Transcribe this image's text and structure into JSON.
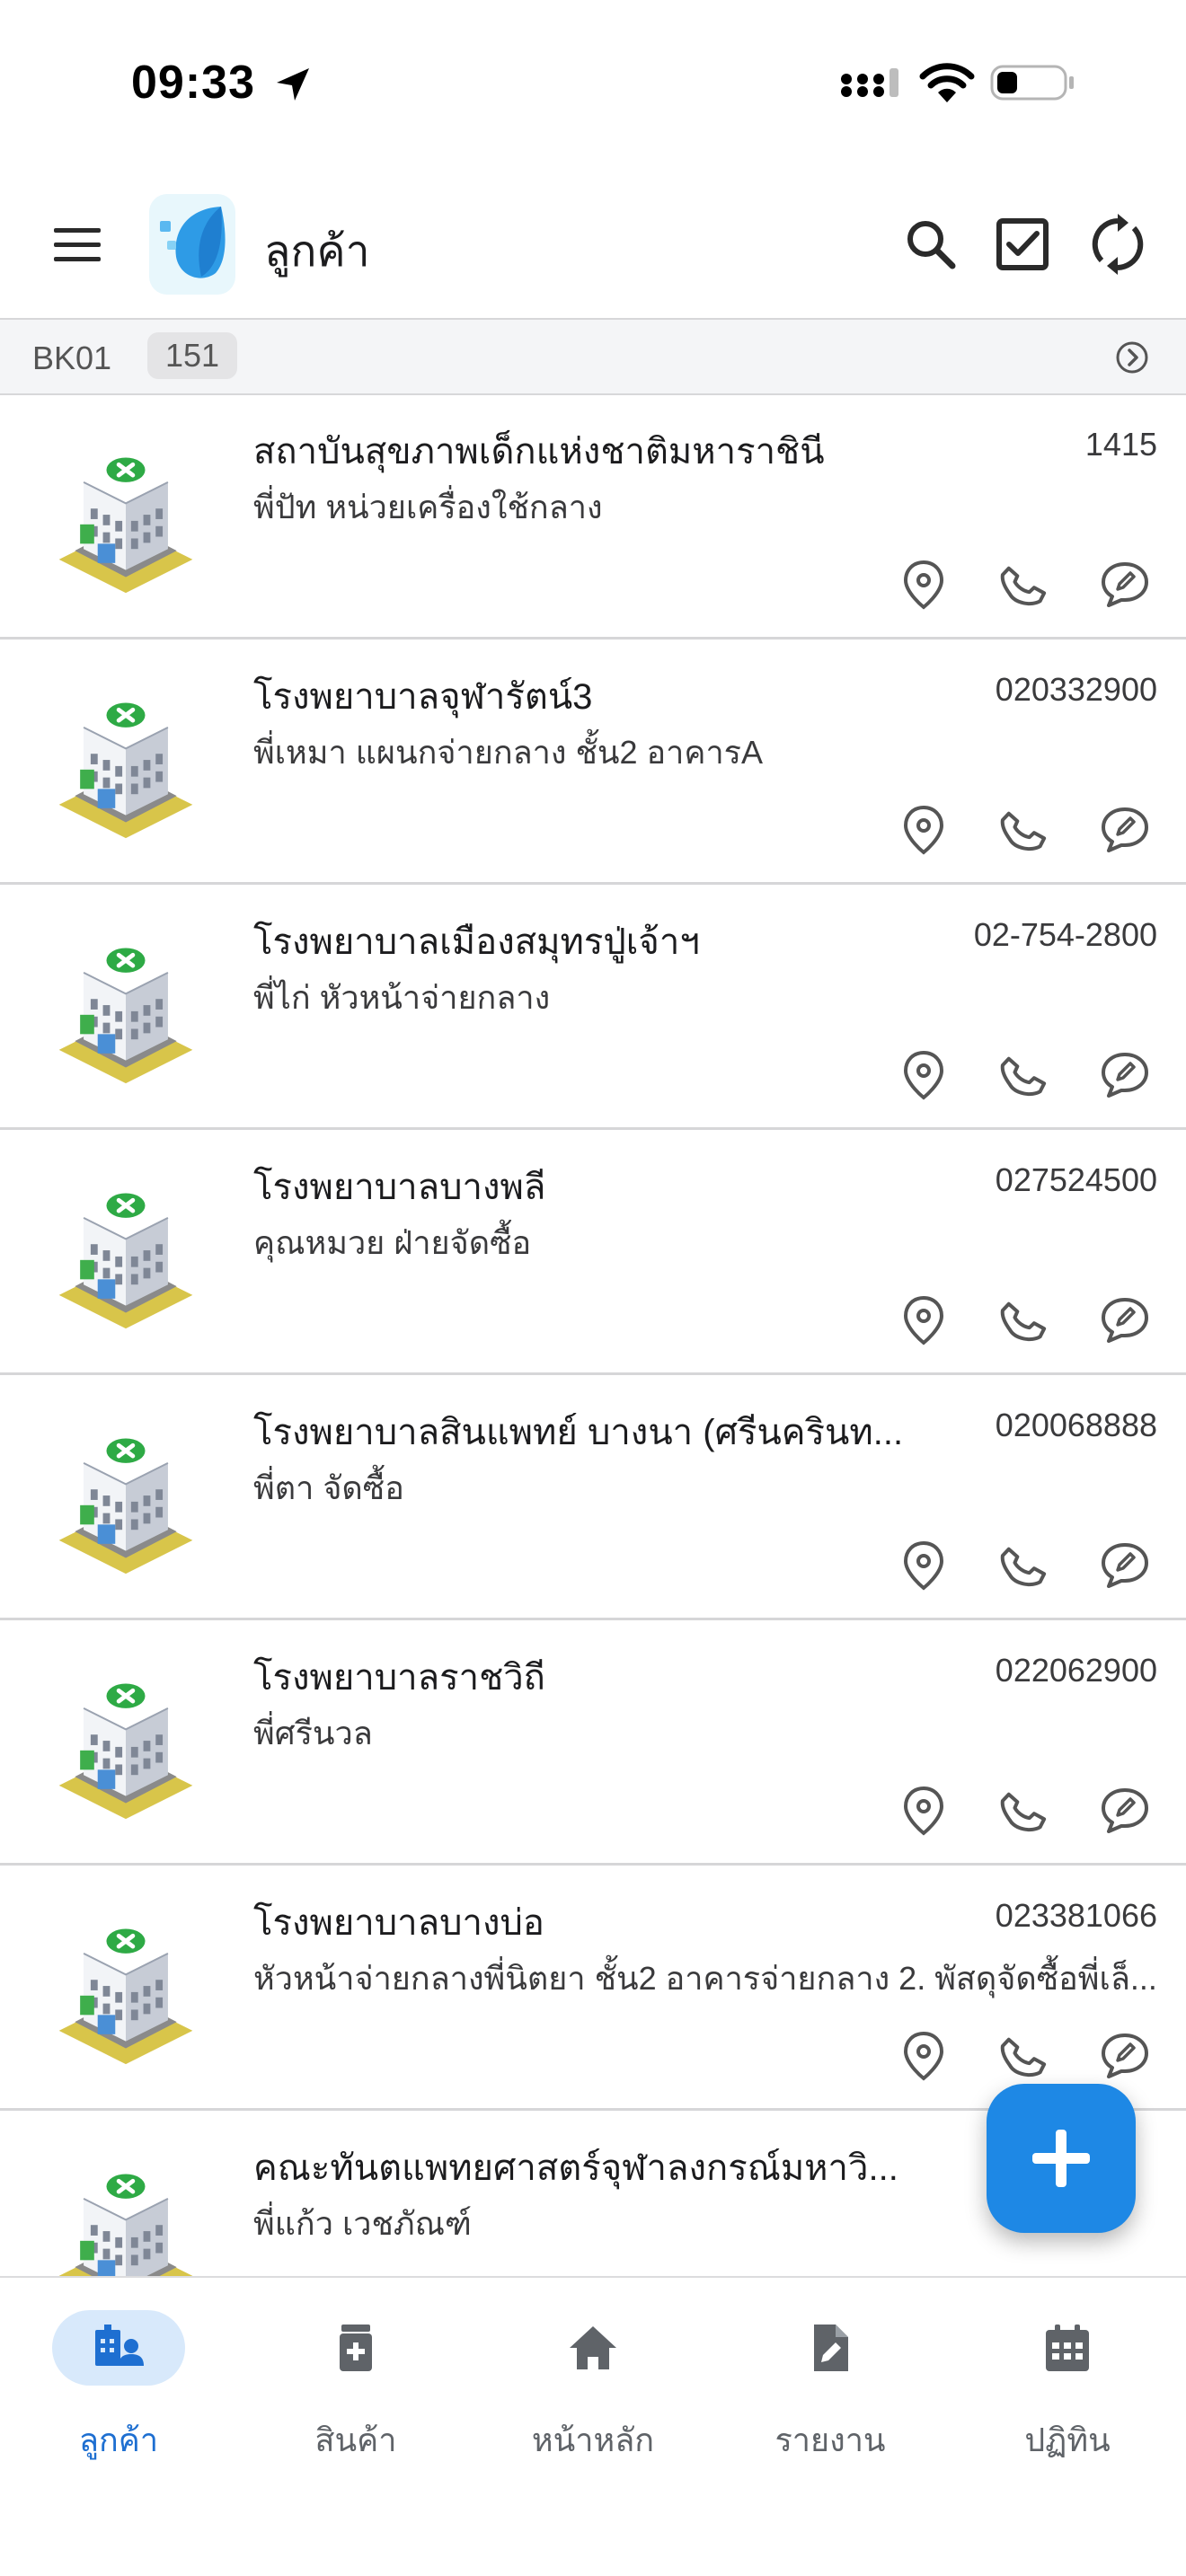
{
  "status_bar": {
    "time": "09:33"
  },
  "app_bar": {
    "title": "ลูกค้า"
  },
  "route": {
    "code": "BK01",
    "count": "151"
  },
  "customers": [
    {
      "name": "สถาบันสุขภาพเด็กแห่งชาติมหาราชินี",
      "phone": "1415",
      "contact": "พี่ปัท หน่วยเครื่องใช้กลาง"
    },
    {
      "name": "โรงพยาบาลจุฬารัตน์3",
      "phone": "020332900",
      "contact": "พี่เหมา แผนกจ่ายกลาง ชั้น2 อาคารA"
    },
    {
      "name": "โรงพยาบาลเมืองสมุทรปู่เจ้าฯ",
      "phone": "02-754-2800",
      "contact": "พี่ไก่ หัวหน้าจ่ายกลาง"
    },
    {
      "name": "โรงพยาบาลบางพลี",
      "phone": "027524500",
      "contact": "คุณหมวย ฝ่ายจัดซื้อ"
    },
    {
      "name": "โรงพยาบาลสินแพทย์ บางนา (ศรีนครินท...",
      "phone": "020068888",
      "contact": "พี่ตา จัดซื้อ"
    },
    {
      "name": "โรงพยาบาลราชวิถี",
      "phone": "022062900",
      "contact": "พี่ศรีนวล"
    },
    {
      "name": "โรงพยาบาลบางบ่อ",
      "phone": "023381066",
      "contact": "หัวหน้าจ่ายกลางพี่นิตยา ชั้น2 อาคารจ่ายกลาง 2. พัสดุจัดซื้อพี่เล็..."
    },
    {
      "name": "คณะทันตแพทยศาสตร์จุฬาลงกรณ์มหาวิ...",
      "phone": "",
      "contact": "พี่แก้ว เวชภัณฑ์"
    }
  ],
  "icons": {
    "customer_actions": [
      "location-pin-icon",
      "phone-icon",
      "comment-edit-icon"
    ],
    "app_bar": [
      "menu-icon",
      "search-icon",
      "checkbox-icon",
      "sync-icon"
    ]
  },
  "bottom_nav": [
    {
      "label": "ลูกค้า",
      "icon": "customers-icon",
      "active": true
    },
    {
      "label": "สินค้า",
      "icon": "product-icon",
      "active": false
    },
    {
      "label": "หน้าหลัก",
      "icon": "home-icon",
      "active": false
    },
    {
      "label": "รายงาน",
      "icon": "report-icon",
      "active": false
    },
    {
      "label": "ปฏิทิน",
      "icon": "calendar-icon",
      "active": false
    }
  ],
  "colors": {
    "accent": "#1e88e5",
    "active_nav": "#1e6fd1",
    "active_pill": "#d8e9fb",
    "route_bar": "#f4f5f7"
  }
}
